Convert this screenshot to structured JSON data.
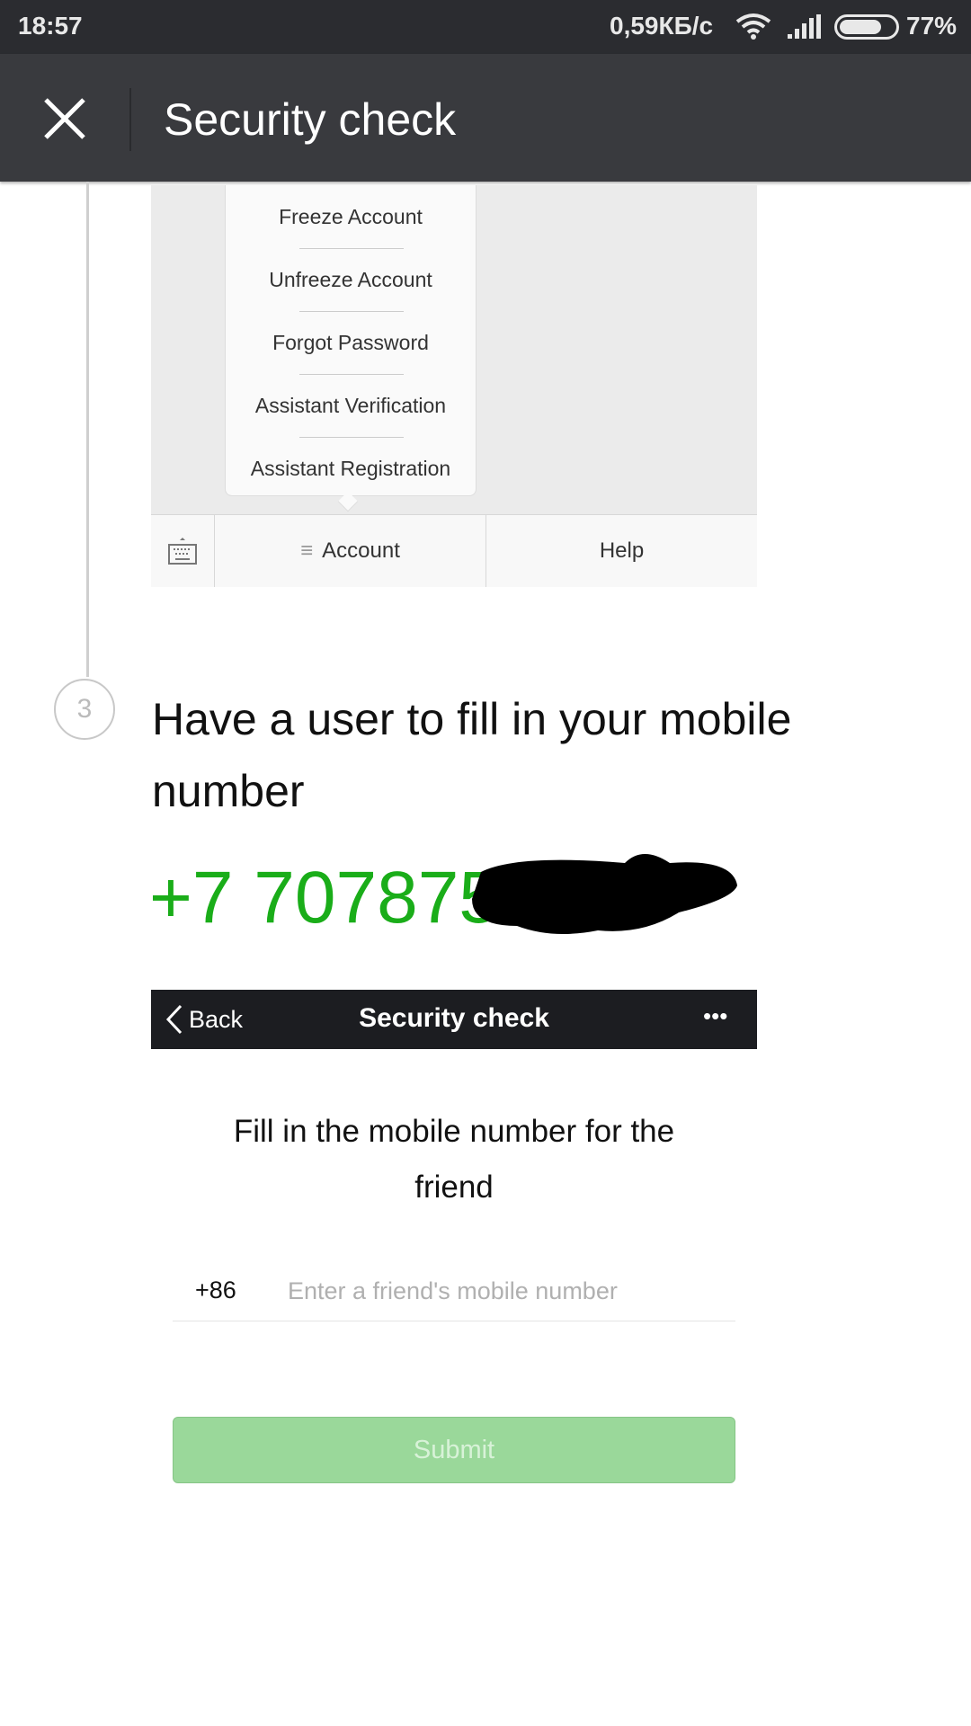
{
  "status_bar": {
    "time": "18:57",
    "net_speed": "0,59КБ/с",
    "battery": "77%",
    "battery_level": 0.77
  },
  "app_bar": {
    "title": "Security check",
    "close_icon": "close-icon"
  },
  "embedded_menu": {
    "items": [
      "Freeze Account",
      "Unfreeze Account",
      "Forgot Password",
      "Assistant Verification",
      "Assistant Registration"
    ],
    "tabs": {
      "account": "Account",
      "help": "Help"
    }
  },
  "step": {
    "number": "3",
    "heading_line1": "Have a user to fill in your mobile",
    "heading_line2": "number",
    "phone": "+7 707875",
    "accent": "#1aad19"
  },
  "embedded_screen": {
    "back": "Back",
    "title": "Security check",
    "more": "•••",
    "prompt_line1": "Fill in the mobile number for the",
    "prompt_line2": "friend",
    "country_code": "+86",
    "placeholder": "Enter a friend's mobile number",
    "submit": "Submit",
    "submit_color": "#9ad89a"
  }
}
